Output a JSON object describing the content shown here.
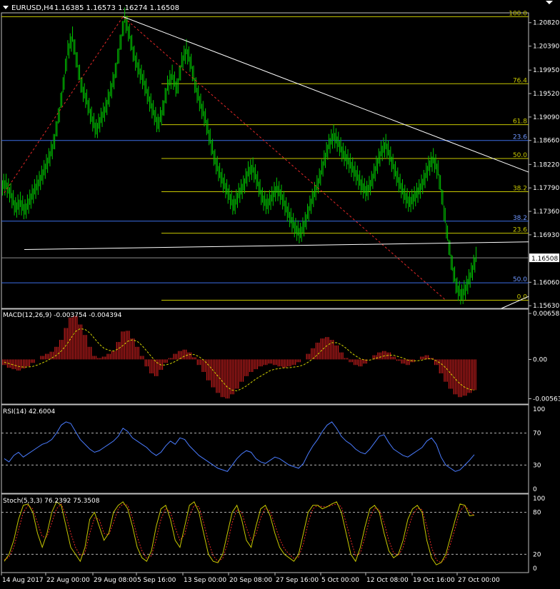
{
  "header": {
    "symbol": "EURUSD,H4",
    "quote": "1.16385 1.16573 1.16274 1.16508"
  },
  "colors": {
    "background": "#000000",
    "frame": "#c0c0c0",
    "candle": "#00c800",
    "fibo_yellow": "#c8c800",
    "fibo_blue": "#3c6ee6",
    "trend_white": "#ffffff",
    "dashed_red": "#e62828",
    "macd_hist": "#c81e1e",
    "macd_signal": "#d2d200",
    "rsi_line": "#4a7cff",
    "stoch_main": "#c8c800",
    "stoch_signal": "#e62828",
    "level_dash": "#b4b4b4"
  },
  "chart_data": [
    {
      "name": "price",
      "type": "bar",
      "axis_ticks": [
        "1.20820",
        "1.20390",
        "1.19950",
        "1.19520",
        "1.19090",
        "1.18660",
        "1.18220",
        "1.17790",
        "1.17360",
        "1.16930",
        "1.16060",
        "1.15630"
      ],
      "ylim": [
        1.1558,
        1.21
      ],
      "current_price": "1.16508",
      "current_value": 1.16508,
      "swing_high": 1.2093,
      "swing_low": 1.1573,
      "closes": [
        1.1785,
        1.1768,
        1.1742,
        1.1752,
        1.1738,
        1.1756,
        1.1775,
        1.179,
        1.181,
        1.1832,
        1.1858,
        1.1905,
        1.1962,
        1.203,
        1.2055,
        1.2008,
        1.1962,
        1.194,
        1.1908,
        1.1885,
        1.1906,
        1.1925,
        1.1955,
        1.1988,
        1.204,
        1.209,
        1.206,
        1.202,
        1.1995,
        1.1975,
        1.1945,
        1.192,
        1.1895,
        1.192,
        1.1965,
        1.1985,
        1.196,
        1.2008,
        1.2032,
        1.2005,
        1.1962,
        1.1932,
        1.1905,
        1.1868,
        1.183,
        1.1805,
        1.1785,
        1.1765,
        1.1745,
        1.1768,
        1.1782,
        1.1808,
        1.1815,
        1.179,
        1.176,
        1.1748,
        1.1762,
        1.1778,
        1.1765,
        1.1742,
        1.1722,
        1.1704,
        1.1695,
        1.1715,
        1.1745,
        1.177,
        1.1795,
        1.1828,
        1.1858,
        1.1875,
        1.1862,
        1.1842,
        1.183,
        1.1815,
        1.18,
        1.1782,
        1.1772,
        1.179,
        1.1818,
        1.1845,
        1.1858,
        1.1835,
        1.1808,
        1.1785,
        1.1765,
        1.1752,
        1.1762,
        1.1775,
        1.1792,
        1.1818,
        1.1832,
        1.181,
        1.1755,
        1.169,
        1.1635,
        1.1595,
        1.1582,
        1.1598,
        1.1622,
        1.1651
      ],
      "fibonacci_levels": [
        {
          "label": "100.0",
          "value": 1.2093
        },
        {
          "label": "76.4",
          "value": 1.197
        },
        {
          "label": "61.8",
          "value": 1.1895
        },
        {
          "label": "50.0",
          "value": 1.1833
        },
        {
          "label": "38.2",
          "value": 1.1772
        },
        {
          "label": "23.6",
          "value": 1.1696
        },
        {
          "label": "0.0",
          "value": 1.1573
        }
      ],
      "blue_levels": [
        {
          "label": "23.6",
          "value": 1.1866
        },
        {
          "label": "38.2",
          "value": 1.1718
        },
        {
          "label": "50.0",
          "value": 1.1605
        }
      ]
    },
    {
      "name": "macd",
      "type": "line",
      "title": "MACD(12,26,9) -0.003754 -0.004394",
      "axis_ticks": [
        "0.006583",
        "0.00",
        "-0.005634"
      ],
      "ylim": [
        -0.0064,
        0.0072
      ],
      "histogram": [
        -0.0008,
        -0.0012,
        -0.0014,
        -0.0016,
        -0.0013,
        -0.001,
        -0.0005,
        0.0,
        0.0005,
        0.0008,
        0.0011,
        0.0018,
        0.0028,
        0.0045,
        0.006,
        0.0062,
        0.005,
        0.0035,
        0.0018,
        0.0005,
        0.0002,
        0.0004,
        0.0008,
        0.0012,
        0.0025,
        0.004,
        0.0041,
        0.003,
        0.0018,
        0.0005,
        -0.001,
        -0.002,
        -0.0024,
        -0.0015,
        -0.0005,
        0.0002,
        0.0008,
        0.0012,
        0.0014,
        0.001,
        0.0003,
        -0.0008,
        -0.0018,
        -0.003,
        -0.004,
        -0.0048,
        -0.0054,
        -0.0056,
        -0.005,
        -0.0042,
        -0.0032,
        -0.0024,
        -0.0018,
        -0.0014,
        -0.001,
        -0.0008,
        -0.0006,
        -0.0008,
        -0.001,
        -0.0012,
        -0.001,
        -0.0008,
        -0.0004,
        0.0,
        0.0008,
        0.0016,
        0.0024,
        0.003,
        0.0032,
        0.0028,
        0.002,
        0.001,
        0.0002,
        -0.0004,
        -0.0008,
        -0.001,
        -0.0006,
        0.0,
        0.0006,
        0.001,
        0.0012,
        0.001,
        0.0004,
        -0.0002,
        -0.0006,
        -0.0008,
        -0.0004,
        0.0,
        0.0004,
        0.0006,
        0.0002,
        -0.0008,
        -0.002,
        -0.0032,
        -0.0042,
        -0.005,
        -0.0054,
        -0.0052,
        -0.0048,
        -0.0044
      ],
      "signal": [
        -0.0004,
        -0.0006,
        -0.0008,
        -0.001,
        -0.0011,
        -0.0011,
        -0.001,
        -0.0008,
        -0.0005,
        -0.0002,
        0.0002,
        0.0006,
        0.0012,
        0.002,
        0.003,
        0.004,
        0.0044,
        0.0043,
        0.0038,
        0.003,
        0.0022,
        0.0016,
        0.0013,
        0.0012,
        0.0015,
        0.002,
        0.0026,
        0.0028,
        0.0026,
        0.002,
        0.0012,
        0.0004,
        -0.0004,
        -0.0008,
        -0.0008,
        -0.0006,
        -0.0003,
        0.0001,
        0.0005,
        0.0007,
        0.0007,
        0.0004,
        -0.0001,
        -0.0008,
        -0.0016,
        -0.0024,
        -0.0032,
        -0.004,
        -0.0044,
        -0.0045,
        -0.0042,
        -0.0038,
        -0.0033,
        -0.0028,
        -0.0024,
        -0.002,
        -0.0016,
        -0.0014,
        -0.0013,
        -0.0012,
        -0.0012,
        -0.0011,
        -0.001,
        -0.0008,
        -0.0004,
        0.0001,
        0.0007,
        0.0014,
        0.002,
        0.0024,
        0.0024,
        0.0021,
        0.0016,
        0.001,
        0.0005,
        0.0001,
        -0.0001,
        -0.0001,
        0.0001,
        0.0003,
        0.0005,
        0.0006,
        0.0006,
        0.0004,
        0.0002,
        -0.0001,
        -0.0002,
        -0.0002,
        -0.0001,
        0.0001,
        0.0001,
        -0.0002,
        -0.0006,
        -0.0012,
        -0.002,
        -0.0028,
        -0.0035,
        -0.004,
        -0.0043,
        -0.0044
      ]
    },
    {
      "name": "rsi",
      "type": "line",
      "title": "RSI(14) 42.6004",
      "axis_ticks": [
        "100",
        "70",
        "30",
        "0"
      ],
      "ylim": [
        0,
        100
      ],
      "levels": [
        70,
        30
      ],
      "values": [
        38,
        34,
        42,
        46,
        40,
        44,
        48,
        52,
        56,
        58,
        62,
        70,
        80,
        84,
        82,
        72,
        62,
        56,
        50,
        46,
        48,
        52,
        56,
        60,
        66,
        76,
        72,
        64,
        60,
        56,
        52,
        46,
        42,
        46,
        54,
        60,
        56,
        64,
        62,
        54,
        48,
        42,
        38,
        34,
        30,
        26,
        24,
        22,
        30,
        38,
        44,
        48,
        46,
        38,
        34,
        32,
        36,
        40,
        38,
        34,
        30,
        28,
        26,
        32,
        44,
        54,
        62,
        72,
        80,
        84,
        76,
        66,
        60,
        56,
        50,
        46,
        44,
        50,
        58,
        66,
        68,
        58,
        50,
        46,
        42,
        40,
        44,
        48,
        52,
        60,
        64,
        56,
        40,
        30,
        26,
        22,
        24,
        30,
        36,
        43
      ]
    },
    {
      "name": "stochastic",
      "type": "line",
      "title": "Stoch(5,3,3) 76.2392 75.3508",
      "axis_ticks": [
        "100",
        "80",
        "20",
        "0"
      ],
      "ylim": [
        0,
        100
      ],
      "levels": [
        80,
        20
      ],
      "main": [
        10,
        20,
        40,
        70,
        90,
        92,
        80,
        50,
        30,
        50,
        80,
        95,
        90,
        60,
        30,
        20,
        10,
        30,
        70,
        80,
        60,
        40,
        50,
        80,
        90,
        95,
        85,
        60,
        30,
        15,
        10,
        25,
        60,
        85,
        90,
        70,
        40,
        30,
        60,
        90,
        95,
        80,
        50,
        20,
        10,
        8,
        20,
        50,
        80,
        90,
        70,
        40,
        30,
        60,
        85,
        90,
        75,
        50,
        30,
        20,
        15,
        10,
        20,
        50,
        80,
        90,
        90,
        85,
        88,
        92,
        95,
        80,
        50,
        20,
        10,
        30,
        60,
        85,
        90,
        80,
        50,
        25,
        15,
        20,
        40,
        70,
        85,
        90,
        80,
        40,
        15,
        5,
        8,
        20,
        45,
        70,
        92,
        90,
        75,
        76
      ],
      "signal": [
        12,
        16,
        30,
        55,
        80,
        90,
        85,
        65,
        45,
        45,
        65,
        85,
        92,
        75,
        50,
        30,
        18,
        22,
        50,
        72,
        70,
        50,
        48,
        65,
        85,
        92,
        90,
        72,
        45,
        25,
        14,
        18,
        42,
        70,
        86,
        80,
        58,
        40,
        48,
        75,
        90,
        88,
        65,
        38,
        18,
        10,
        14,
        35,
        65,
        84,
        80,
        58,
        40,
        48,
        72,
        86,
        82,
        62,
        42,
        28,
        20,
        14,
        16,
        35,
        65,
        85,
        90,
        88,
        88,
        90,
        92,
        88,
        65,
        40,
        18,
        22,
        45,
        72,
        86,
        84,
        65,
        40,
        22,
        18,
        30,
        55,
        76,
        86,
        84,
        60,
        30,
        12,
        8,
        15,
        35,
        58,
        82,
        90,
        82,
        75
      ]
    }
  ],
  "x_axis_labels": [
    "14 Aug 2017",
    "22 Aug 00:00",
    "29 Aug 08:00",
    "5 Sep 16:00",
    "13 Sep 00:00",
    "20 Sep 08:00",
    "27 Sep 16:00",
    "5 Oct 00:00",
    "12 Oct 08:00",
    "19 Oct 16:00",
    "27 Oct 00:00"
  ]
}
